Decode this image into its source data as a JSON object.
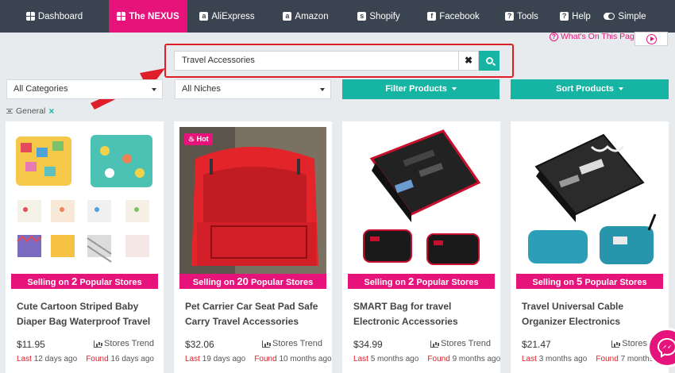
{
  "nav": {
    "items": [
      {
        "label": "Dashboard",
        "icon": "dashboard-icon"
      },
      {
        "label": "The NEXUS",
        "icon": "nexus-icon",
        "active": true
      },
      {
        "label": "AliExpress",
        "icon": "aliexpress-icon"
      },
      {
        "label": "Amazon",
        "icon": "amazon-icon"
      },
      {
        "label": "Shopify",
        "icon": "shopify-icon"
      },
      {
        "label": "Facebook",
        "icon": "facebook-icon"
      },
      {
        "label": "Tools",
        "icon": "tools-icon"
      },
      {
        "label": "Help",
        "icon": "help-icon"
      },
      {
        "label": "Simple",
        "icon": "toggle-icon"
      }
    ],
    "accent": "#e6137b",
    "background": "#3a4450"
  },
  "whats_on_page": "What's On This Page",
  "search": {
    "value": "Travel Accessories",
    "clear_icon": "close-icon",
    "search_icon": "search-icon"
  },
  "filters": {
    "categories": "All Categories",
    "niches": "All Niches",
    "filter_products": "Filter Products",
    "sort_products": "Sort Products",
    "tag": "General"
  },
  "teal": "#16b5a3",
  "cards": [
    {
      "band_prefix": "Selling on ",
      "count": "2",
      "band_suffix": " Popular Stores",
      "title": "Cute Cartoon Striped Baby Diaper Bag Waterproof Travel",
      "price": "$11.95",
      "trend": "Stores Trend",
      "last_label": "Last",
      "last": "12 days ago",
      "found_label": "Found",
      "found": "16 days ago"
    },
    {
      "badge": "Hot",
      "band_prefix": "Selling on ",
      "count": "20",
      "band_suffix": " Popular Stores",
      "title": "Pet Carrier Car Seat Pad Safe Carry Travel Accessories",
      "price": "$32.06",
      "trend": "Stores Trend",
      "last_label": "Last",
      "last": "19 days ago",
      "found_label": "Found",
      "found": "10 months ago"
    },
    {
      "band_prefix": "Selling on ",
      "count": "2",
      "band_suffix": " Popular Stores",
      "title": "SMART Bag for travel Electronic Accessories",
      "price": "$34.99",
      "trend": "Stores Trend",
      "last_label": "Last",
      "last": "5 months ago",
      "found_label": "Found",
      "found": "9 months ago"
    },
    {
      "band_prefix": "Selling on ",
      "count": "5",
      "band_suffix": " Popular Stores",
      "title": "Travel Universal Cable Organizer Electronics",
      "price": "$21.47",
      "trend": "Stores Tre",
      "last_label": "Last",
      "last": "3 months ago",
      "found_label": "Found",
      "found": "7 months ago"
    }
  ]
}
